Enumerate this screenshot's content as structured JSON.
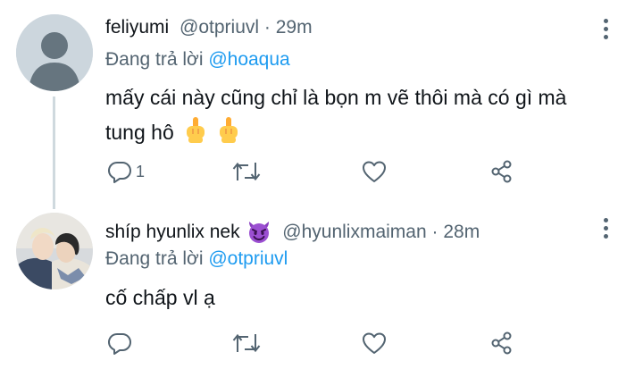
{
  "tweets": [
    {
      "display_name": "feliyumi",
      "handle": "@otpriuvl",
      "separator": "·",
      "time": "29m",
      "reply_prefix": "Đang trả lời",
      "reply_to": "@hoaqua",
      "text_line1": "mấy cái này cũng chỉ là bọn m vẽ thôi mà có gì mà",
      "text_line2": "tung hô",
      "emoji": [
        "middle-finger-emoji",
        "middle-finger-emoji"
      ],
      "reply_count": "1",
      "avatar": "default-avatar-icon"
    },
    {
      "display_name": "shíp hyunlix nek",
      "name_emoji": "smiling-devil-emoji",
      "handle": "@hyunlixmaiman",
      "separator": "·",
      "time": "28m",
      "reply_prefix": "Đang trả lời",
      "reply_to": "@otpriuvl",
      "text_line1": "cố chấp vl ạ",
      "reply_count": "",
      "avatar": "profile-photo"
    }
  ],
  "colors": {
    "text": "#0f1419",
    "secondary": "#536471",
    "link": "#1d9bf0",
    "thread_line": "#cfd9de",
    "devil": "#8b3fc1"
  }
}
